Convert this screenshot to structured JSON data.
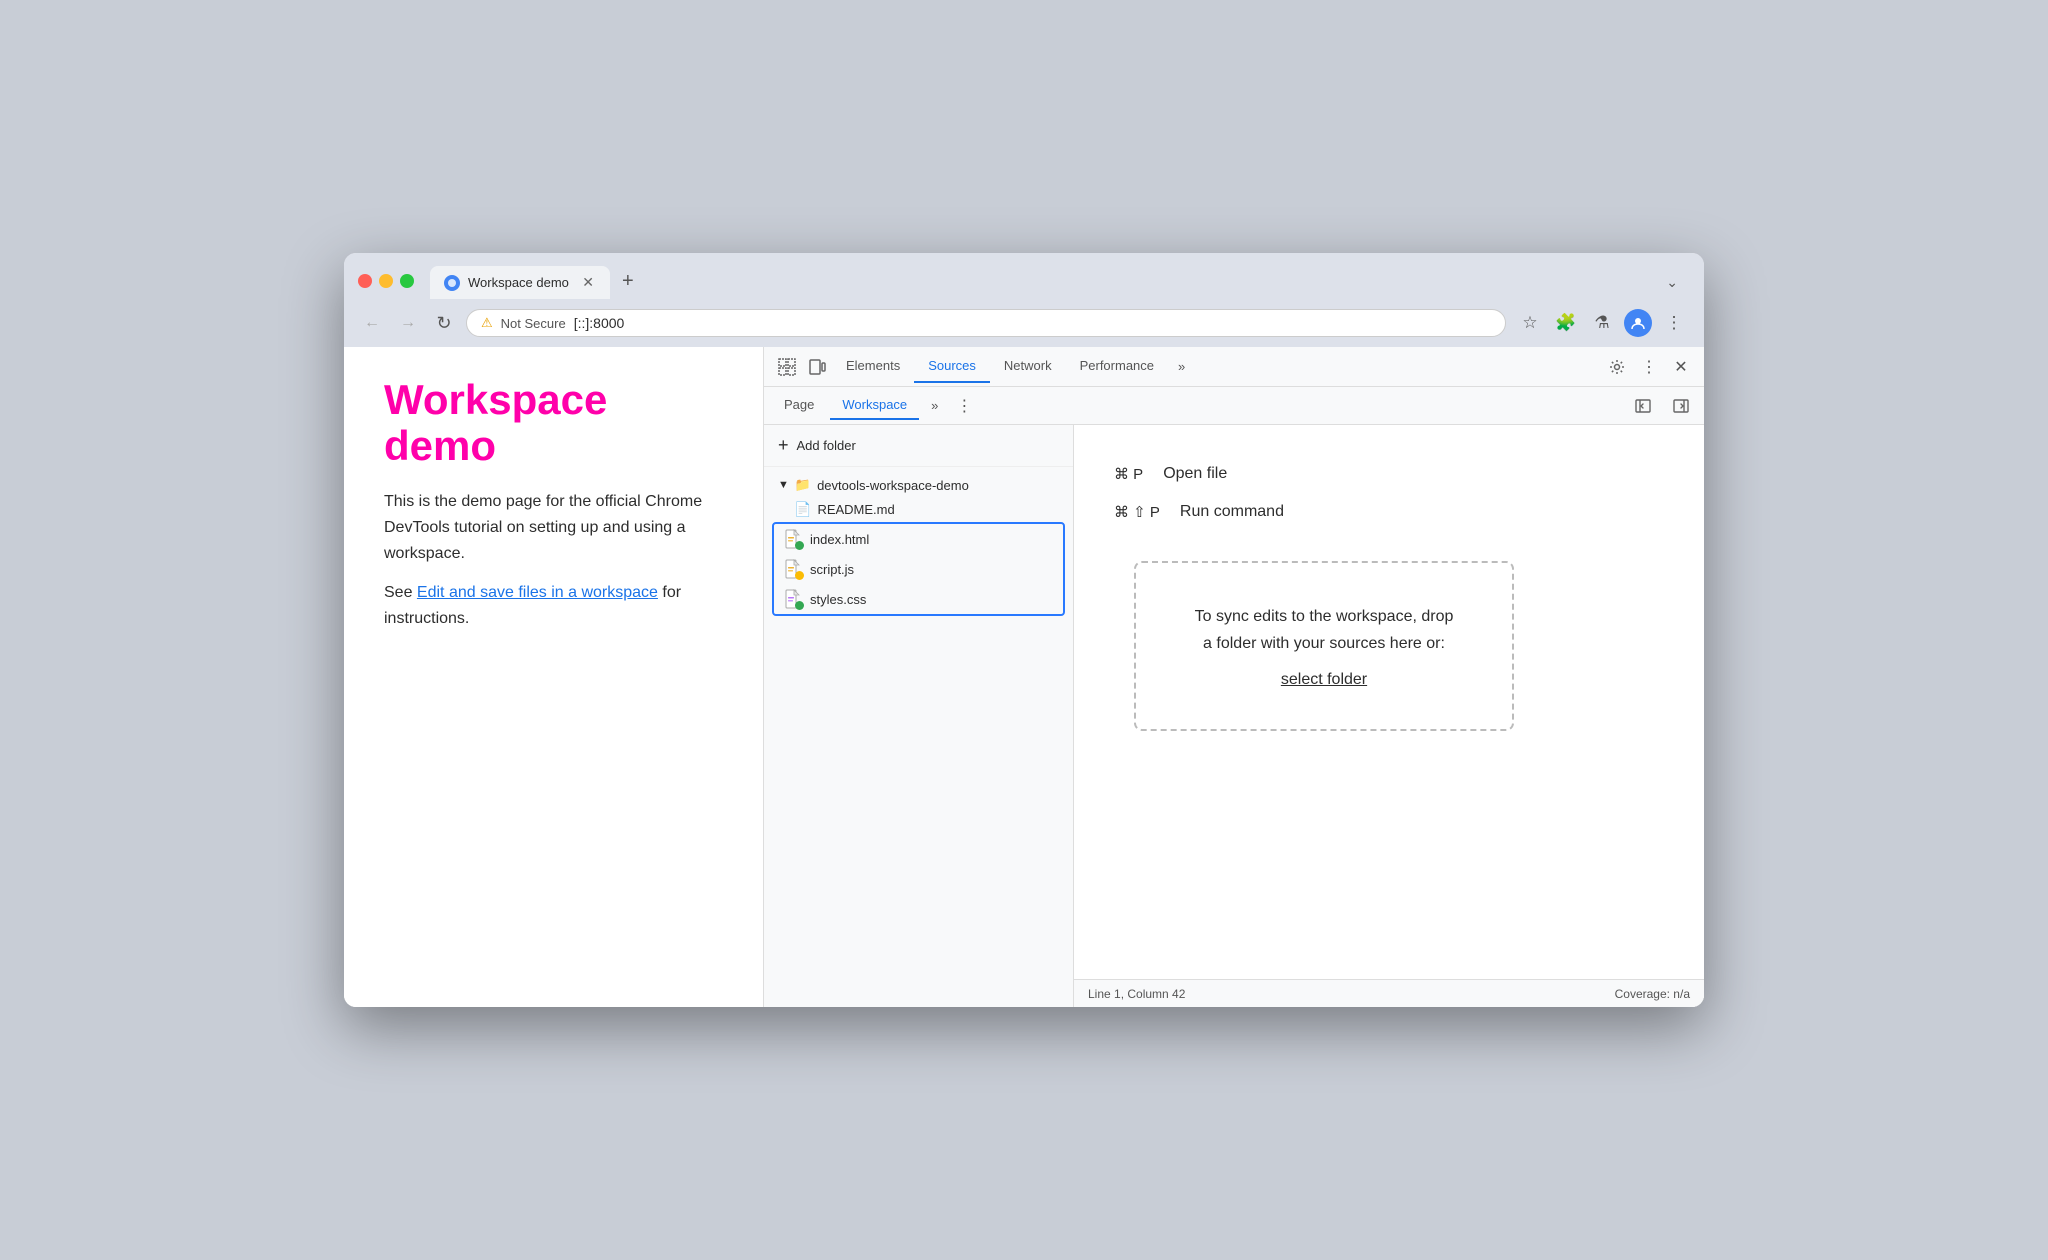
{
  "browser": {
    "tab_title": "Workspace demo",
    "url_secure_label": "Not Secure",
    "url": "[::]:8000",
    "new_tab_symbol": "+",
    "tab_overflow_symbol": "⌄"
  },
  "toolbar": {
    "back_label": "←",
    "forward_label": "→",
    "refresh_label": "↻"
  },
  "webpage": {
    "title": "Workspace demo",
    "description": "This is the demo page for the official Chrome DevTools tutorial on setting up and using a workspace.",
    "link_prefix": "See ",
    "link_text": "Edit and save files in a workspace",
    "link_suffix": " for instructions."
  },
  "devtools": {
    "tabs": [
      {
        "label": "Elements",
        "active": false
      },
      {
        "label": "Sources",
        "active": true
      },
      {
        "label": "Network",
        "active": false
      },
      {
        "label": "Performance",
        "active": false
      }
    ],
    "more_tabs_symbol": "»",
    "sources_tabs": [
      {
        "label": "Page",
        "active": false
      },
      {
        "label": "Workspace",
        "active": true
      }
    ],
    "sources_more_symbol": "»",
    "add_folder_label": "Add folder",
    "folder_name": "devtools-workspace-demo",
    "files": [
      {
        "name": "README.md",
        "type": "plain",
        "dot_color": null
      },
      {
        "name": "index.html",
        "type": "html",
        "dot_color": "#34a853"
      },
      {
        "name": "script.js",
        "type": "js",
        "dot_color": "#fbbc04"
      },
      {
        "name": "styles.css",
        "type": "css",
        "dot_color": "#34a853"
      }
    ],
    "shortcut1_keys": "⌘ P",
    "shortcut1_label": "Open file",
    "shortcut2_keys": "⌘ ⇧ P",
    "shortcut2_label": "Run command",
    "drop_text1": "To sync edits to the workspace, drop",
    "drop_text2": "a folder with your sources here or:",
    "select_folder_label": "select folder",
    "status_left": "Line 1, Column 42",
    "status_right": "Coverage: n/a"
  }
}
